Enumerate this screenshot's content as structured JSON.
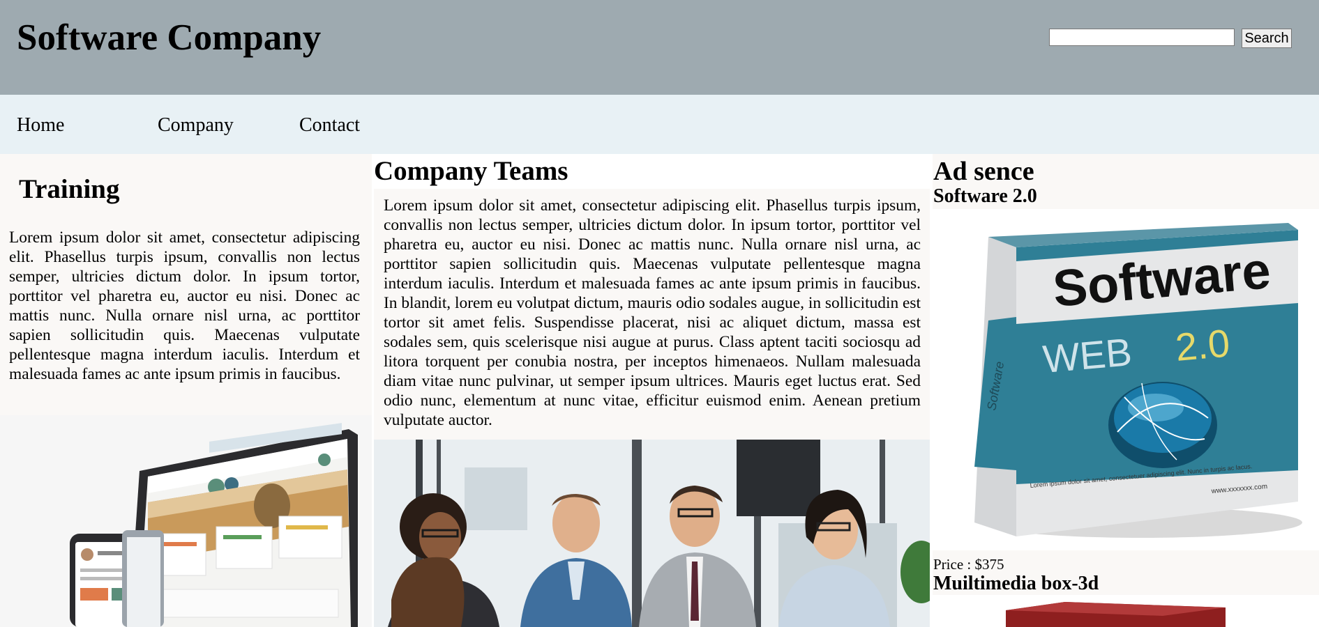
{
  "header": {
    "title": "Software Company",
    "search": {
      "value": "",
      "placeholder": "",
      "button_label": "Search"
    }
  },
  "nav": {
    "items": [
      {
        "label": "Home"
      },
      {
        "label": "Company"
      },
      {
        "label": "Contact"
      }
    ]
  },
  "training": {
    "title": "Training",
    "text": "Lorem ipsum dolor sit amet, consectetur adipiscing elit. Phasellus turpis ipsum, convallis non lectus semper, ultricies dictum dolor. In ipsum tortor, porttitor vel pharetra eu, auctor eu nisi. Donec ac mattis nunc. Nulla ornare nisl urna, ac porttitor sapien sollicitudin quis. Maecenas vulputate pellentesque magna interdum iaculis. Interdum et malesuada fames ac ante ipsum primis in faucibus."
  },
  "teams": {
    "title": "Company Teams",
    "text": "Lorem ipsum dolor sit amet, consectetur adipiscing elit. Phasellus turpis ipsum, convallis non lectus semper, ultricies dictum dolor. In ipsum tortor, porttitor vel pharetra eu, auctor eu nisi. Donec ac mattis nunc. Nulla ornare nisl urna, ac porttitor sapien sollicitudin quis. Maecenas vulputate pellentesque magna interdum iaculis. Interdum et malesuada fames ac ante ipsum primis in faucibus. In blandit, lorem eu volutpat dictum, mauris odio sodales augue, in sollicitudin est tortor sit amet felis. Suspendisse placerat, nisi ac aliquet dictum, massa est sodales sem, quis scelerisque nisi augue at purus. Class aptent taciti sociosqu ad litora torquent per conubia nostra, per inceptos himenaeos. Nullam malesuada diam vitae nunc pulvinar, ut semper ipsum ultrices. Mauris eget luctus erat. Sed odio nunc, elementum at nunc vitae, efficitur euismod enim. Aenean pretium vulputate auctor."
  },
  "ads": {
    "title": "Ad sence",
    "products": [
      {
        "name": "Software 2.0",
        "box_title": "Software",
        "box_subtitle": "WEB",
        "box_version": "2.0",
        "box_side": "Software",
        "box_fine_print": "Lorem ipsum dolor sit amet, consectetuer adipiscing elit. Nunc in turpis ac lacus.",
        "box_url": "www.xxxxxxx.com",
        "price": "Price : $375"
      },
      {
        "name": "Muiltimedia box-3d"
      }
    ]
  },
  "colors": {
    "header_bg": "#9eaab0",
    "nav_bg": "#e8f1f5",
    "panel_bg": "#faf8f6",
    "box_teal": "#2f7f96",
    "box_version_yellow": "#e6d96a"
  },
  "images": {
    "training": "devices-mockup-image",
    "teams": "team-meeting-photo",
    "software_box": "software-box-image",
    "multimedia_box": "multimedia-box-image"
  }
}
